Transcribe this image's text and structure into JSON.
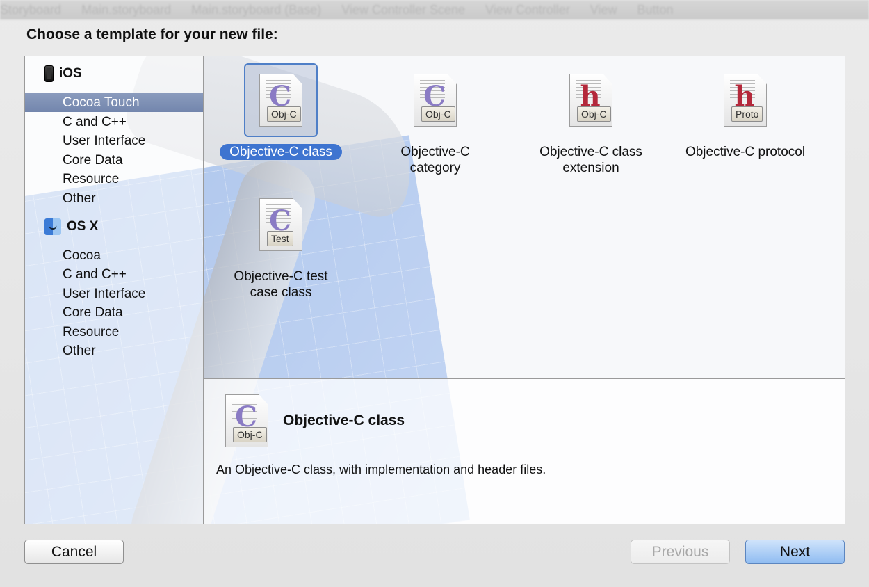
{
  "background_bar": {
    "items": [
      "Storyboard",
      "Main.storyboard",
      "Main.storyboard (Base)",
      "View Controller Scene",
      "View Controller",
      "View",
      "Button"
    ]
  },
  "dialog": {
    "title": "Choose a template for your new file:"
  },
  "sidebar": {
    "sections": [
      {
        "name": "iOS",
        "icon": "iphone-icon",
        "items": [
          {
            "label": "Cocoa Touch",
            "selected": true
          },
          {
            "label": "C and C++",
            "selected": false
          },
          {
            "label": "User Interface",
            "selected": false
          },
          {
            "label": "Core Data",
            "selected": false
          },
          {
            "label": "Resource",
            "selected": false
          },
          {
            "label": "Other",
            "selected": false
          }
        ]
      },
      {
        "name": "OS X",
        "icon": "finder-icon",
        "items": [
          {
            "label": "Cocoa",
            "selected": false
          },
          {
            "label": "C and C++",
            "selected": false
          },
          {
            "label": "User Interface",
            "selected": false
          },
          {
            "label": "Core Data",
            "selected": false
          },
          {
            "label": "Resource",
            "selected": false
          },
          {
            "label": "Other",
            "selected": false
          }
        ]
      }
    ]
  },
  "templates": [
    {
      "label": "Objective-C class",
      "glyph": "C",
      "badge": "Obj-C",
      "selected": true
    },
    {
      "label_line1": "Objective-C",
      "label_line2": "category",
      "glyph": "C",
      "badge": "Obj-C",
      "selected": false
    },
    {
      "label_line1": "Objective-C class",
      "label_line2": "extension",
      "glyph": "h",
      "badge": "Obj-C",
      "selected": false
    },
    {
      "label": "Objective-C protocol",
      "glyph": "h",
      "badge": "Proto",
      "selected": false
    },
    {
      "label_line1": "Objective-C test",
      "label_line2": "case class",
      "glyph": "C",
      "badge": "Test",
      "selected": false
    }
  ],
  "description": {
    "title": "Objective-C class",
    "text": "An Objective-C class, with implementation and header files.",
    "glyph": "C",
    "badge": "Obj-C"
  },
  "buttons": {
    "cancel": "Cancel",
    "previous": "Previous",
    "next": "Next"
  },
  "colors": {
    "selection_blue": "#3e74d0",
    "sidebar_selected": "#7a8db2",
    "glyph_purple": "#8a7bc4",
    "glyph_red": "#b4283a"
  }
}
